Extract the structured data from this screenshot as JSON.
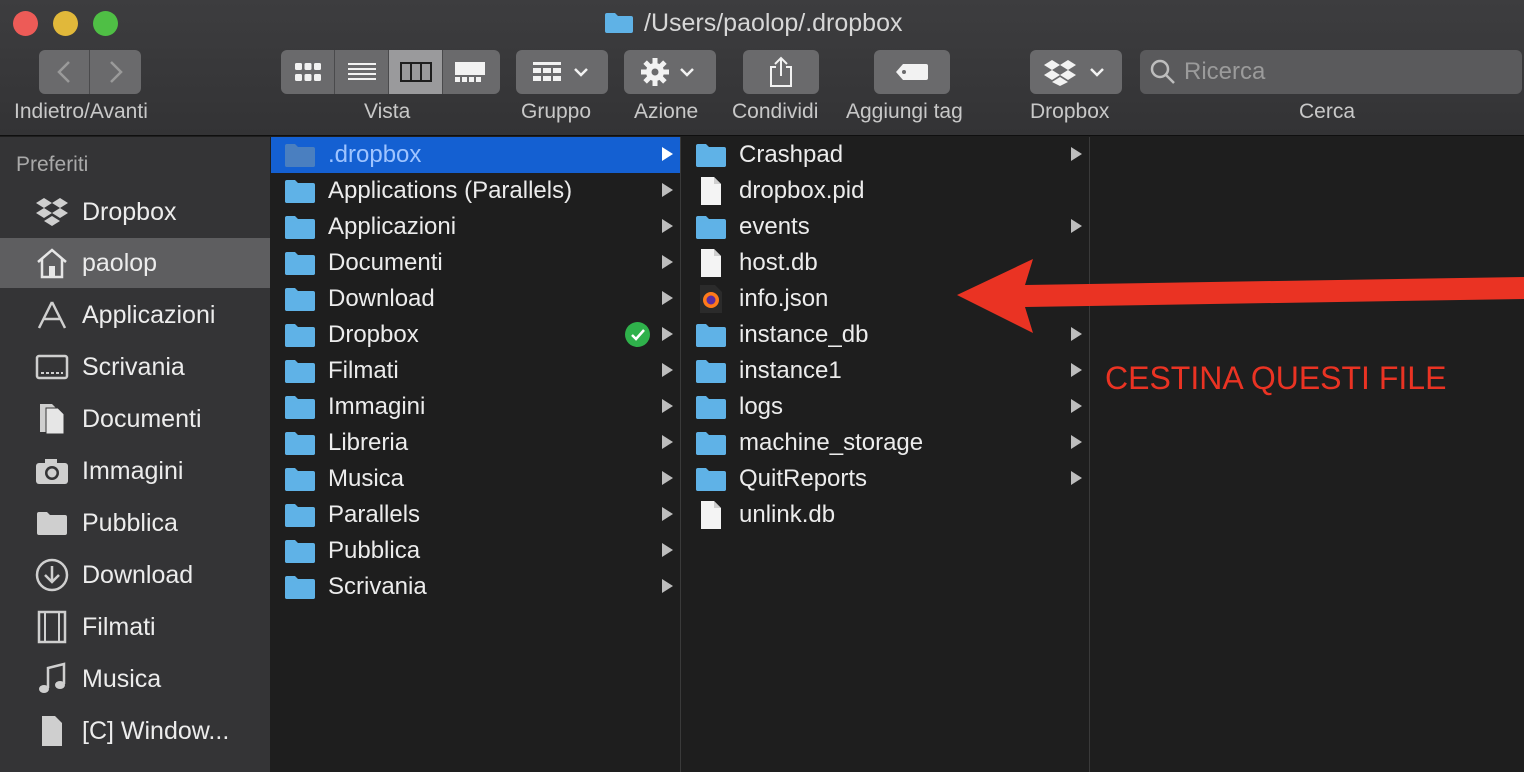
{
  "window": {
    "title": "/Users/paolop/.dropbox"
  },
  "toolbar": {
    "nav_label": "Indietro/Avanti",
    "view_label": "Vista",
    "group_label": "Gruppo",
    "action_label": "Azione",
    "share_label": "Condividi",
    "tag_label": "Aggiungi tag",
    "dropbox_label": "Dropbox",
    "search_label": "Cerca",
    "search_placeholder": "Ricerca"
  },
  "sidebar": {
    "heading": "Preferiti",
    "items": [
      {
        "label": "Dropbox",
        "icon": "dropbox-icon"
      },
      {
        "label": "paolop",
        "icon": "home-icon",
        "selected": true
      },
      {
        "label": "Applicazioni",
        "icon": "applications-icon"
      },
      {
        "label": "Scrivania",
        "icon": "desktop-icon"
      },
      {
        "label": "Documenti",
        "icon": "documents-icon"
      },
      {
        "label": "Immagini",
        "icon": "camera-icon"
      },
      {
        "label": "Pubblica",
        "icon": "folder-icon"
      },
      {
        "label": "Download",
        "icon": "download-icon"
      },
      {
        "label": "Filmati",
        "icon": "film-icon"
      },
      {
        "label": "Musica",
        "icon": "music-icon"
      },
      {
        "label": "[C] Window...",
        "icon": "file-icon"
      }
    ]
  },
  "column1": [
    {
      "name": ".dropbox",
      "selected": true
    },
    {
      "name": "Applications (Parallels)"
    },
    {
      "name": "Applicazioni"
    },
    {
      "name": "Documenti"
    },
    {
      "name": "Download"
    },
    {
      "name": "Dropbox",
      "synced": true
    },
    {
      "name": "Filmati"
    },
    {
      "name": "Immagini"
    },
    {
      "name": "Libreria"
    },
    {
      "name": "Musica"
    },
    {
      "name": "Parallels"
    },
    {
      "name": "Pubblica"
    },
    {
      "name": "Scrivania"
    }
  ],
  "column2": [
    {
      "name": "Crashpad",
      "kind": "folder"
    },
    {
      "name": "dropbox.pid",
      "kind": "file"
    },
    {
      "name": "events",
      "kind": "folder"
    },
    {
      "name": "host.db",
      "kind": "file"
    },
    {
      "name": "info.json",
      "kind": "firefox-file"
    },
    {
      "name": "instance_db",
      "kind": "folder"
    },
    {
      "name": "instance1",
      "kind": "folder"
    },
    {
      "name": "logs",
      "kind": "folder"
    },
    {
      "name": "machine_storage",
      "kind": "folder"
    },
    {
      "name": "QuitReports",
      "kind": "folder"
    },
    {
      "name": "unlink.db",
      "kind": "file"
    }
  ],
  "annotation": {
    "text": "CESTINA QUESTI FILE",
    "color": "#ea3323"
  },
  "colors": {
    "selection": "#1460d2",
    "folder": "#5fb2e6",
    "synced": "#2fb14b"
  }
}
